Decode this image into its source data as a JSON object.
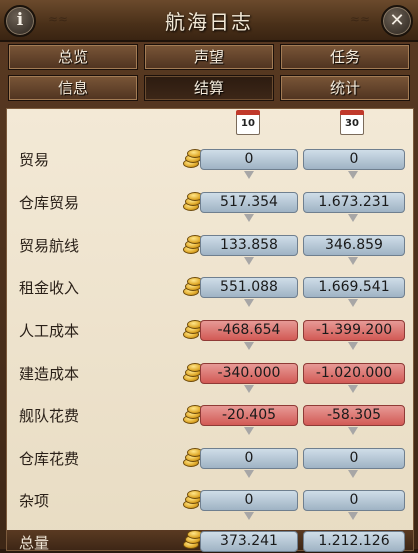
{
  "window": {
    "title": "航海日志"
  },
  "tabs": [
    {
      "label": "总览",
      "active": false
    },
    {
      "label": "声望",
      "active": false
    },
    {
      "label": "任务",
      "active": false
    },
    {
      "label": "信息",
      "active": false
    },
    {
      "label": "结算",
      "active": true
    },
    {
      "label": "统计",
      "active": false
    }
  ],
  "columns": [
    {
      "calendar_day": "10"
    },
    {
      "calendar_day": "30"
    }
  ],
  "rows": [
    {
      "label": "贸易",
      "v10": "0",
      "v30": "0",
      "negative": false
    },
    {
      "label": "仓库贸易",
      "v10": "517.354",
      "v30": "1.673.231",
      "negative": false
    },
    {
      "label": "贸易航线",
      "v10": "133.858",
      "v30": "346.859",
      "negative": false
    },
    {
      "label": "租金收入",
      "v10": "551.088",
      "v30": "1.669.541",
      "negative": false
    },
    {
      "label": "人工成本",
      "v10": "-468.654",
      "v30": "-1.399.200",
      "negative": true
    },
    {
      "label": "建造成本",
      "v10": "-340.000",
      "v30": "-1.020.000",
      "negative": true
    },
    {
      "label": "舰队花费",
      "v10": "-20.405",
      "v30": "-58.305",
      "negative": true
    },
    {
      "label": "仓库花费",
      "v10": "0",
      "v30": "0",
      "negative": false
    },
    {
      "label": "杂项",
      "v10": "0",
      "v30": "0",
      "negative": false
    }
  ],
  "total": {
    "label": "总量",
    "v10": "373.241",
    "v30": "1.212.126"
  },
  "colors": {
    "positive": "#b7c9d8",
    "negative": "#d9605a",
    "panel": "#efe4cf",
    "frame": "#4a3019"
  }
}
